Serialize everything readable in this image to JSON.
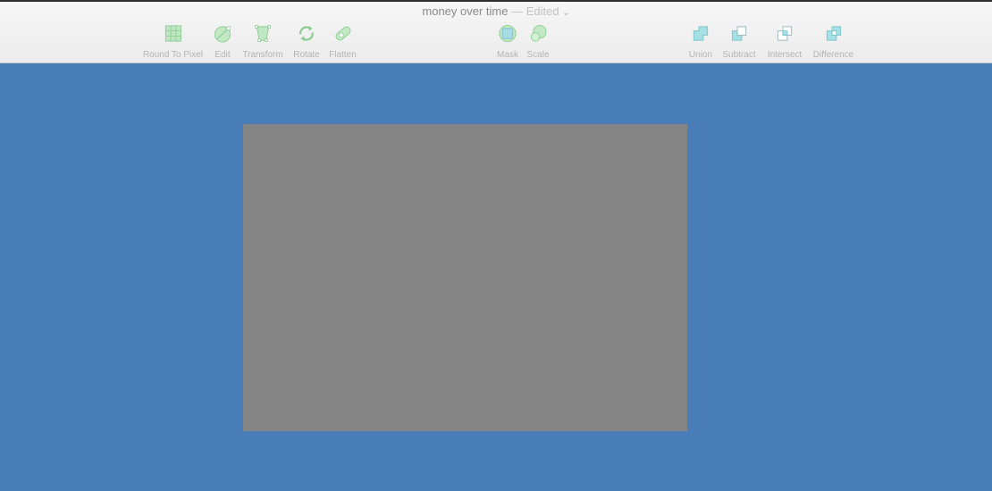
{
  "window": {
    "title": "money over time",
    "separator": " — ",
    "status": "Edited",
    "chevron": "⌄"
  },
  "toolbar": {
    "tools": [
      {
        "label": "Round To Pixel",
        "icon": "round-to-pixel-icon"
      },
      {
        "label": "Edit",
        "icon": "edit-icon"
      },
      {
        "label": "Transform",
        "icon": "transform-icon"
      },
      {
        "label": "Rotate",
        "icon": "rotate-icon"
      },
      {
        "label": "Flatten",
        "icon": "flatten-icon"
      },
      {
        "label": "Mask",
        "icon": "mask-icon"
      },
      {
        "label": "Scale",
        "icon": "scale-icon"
      },
      {
        "label": "Union",
        "icon": "union-icon"
      },
      {
        "label": "Subtract",
        "icon": "subtract-icon"
      },
      {
        "label": "Intersect",
        "icon": "intersect-icon"
      },
      {
        "label": "Difference",
        "icon": "difference-icon"
      }
    ]
  },
  "colors": {
    "canvas": "#497db8",
    "artboard": "#858585",
    "tool_green": "#b9e3bd",
    "tool_teal": "#a6e0e4"
  }
}
